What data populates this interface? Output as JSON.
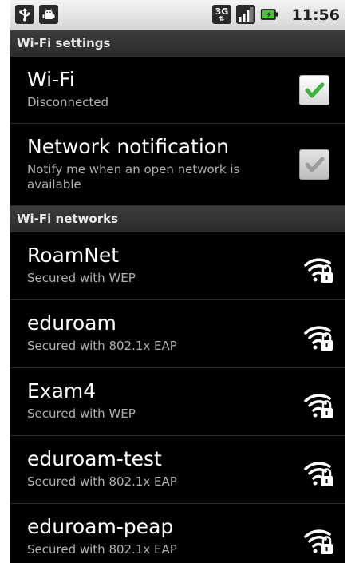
{
  "status_bar": {
    "time": "11:56",
    "network_type": "3G",
    "icons": [
      "usb-icon",
      "android-icon",
      "3g-data-icon",
      "signal-strength-icon",
      "battery-charging-icon"
    ]
  },
  "wifi_settings": {
    "header": "Wi-Fi settings",
    "wifi": {
      "title": "Wi-Fi",
      "summary": "Disconnected",
      "checked": true
    },
    "network_notification": {
      "title": "Network notification",
      "summary": "Notify me when an open network is available",
      "checked": true,
      "enabled": false
    }
  },
  "wifi_networks": {
    "header": "Wi-Fi networks",
    "items": [
      {
        "name": "RoamNet",
        "security": "Secured with WEP",
        "icon": "wifi-locked-icon"
      },
      {
        "name": "eduroam",
        "security": "Secured with 802.1x EAP",
        "icon": "wifi-locked-icon"
      },
      {
        "name": "Exam4",
        "security": "Secured with WEP",
        "icon": "wifi-locked-icon"
      },
      {
        "name": "eduroam-test",
        "security": "Secured with 802.1x EAP",
        "icon": "wifi-locked-icon"
      },
      {
        "name": "eduroam-peap",
        "security": "Secured with 802.1x EAP",
        "icon": "wifi-locked-icon"
      }
    ]
  },
  "colors": {
    "background": "#000000",
    "status_bar": "#e4e4e4",
    "section_header": "#333333",
    "check_green": "#3cb33c",
    "summary_text": "#b0b0b0"
  }
}
